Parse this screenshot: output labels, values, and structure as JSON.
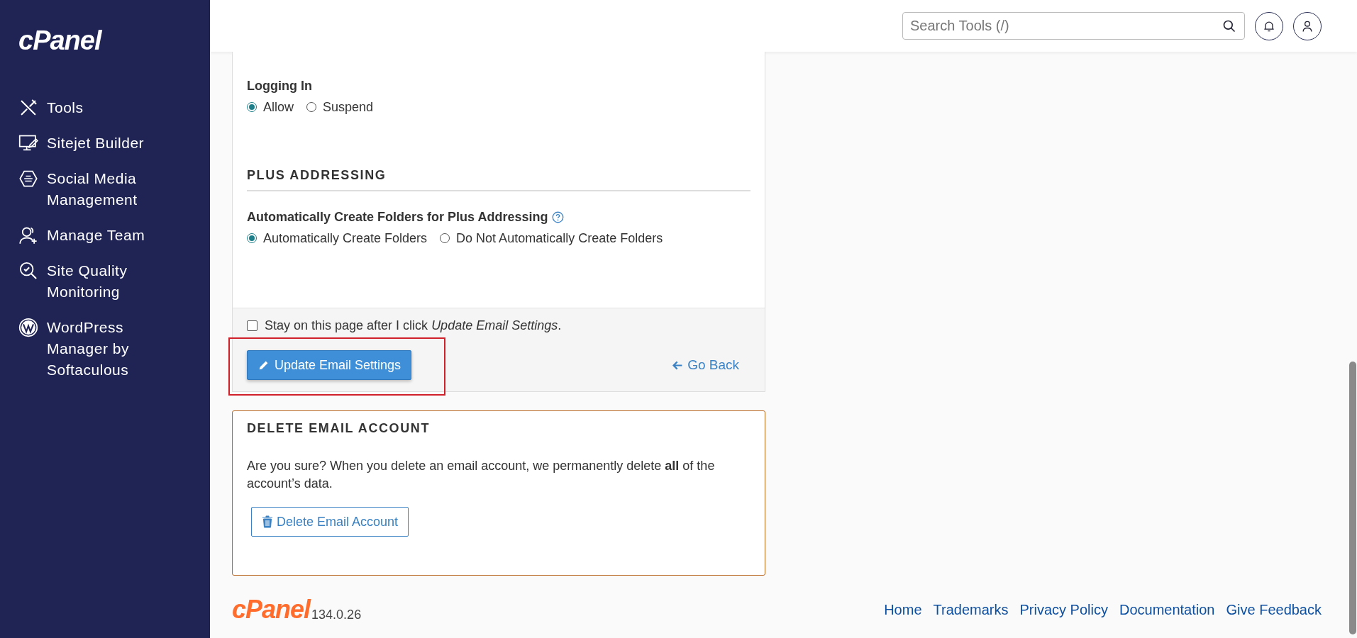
{
  "sidebar": {
    "logo": "cPanel",
    "items": [
      {
        "label": "Tools"
      },
      {
        "label": "Sitejet Builder"
      },
      {
        "label": "Social Media Management"
      },
      {
        "label": "Manage Team"
      },
      {
        "label": "Site Quality Monitoring"
      },
      {
        "label": "WordPress Manager by Softaculous"
      }
    ]
  },
  "header": {
    "search": {
      "placeholder": "Search Tools (/)"
    }
  },
  "settings_card": {
    "logging_in": {
      "label": "Logging In",
      "options": [
        {
          "label": "Allow",
          "selected": true
        },
        {
          "label": "Suspend",
          "selected": false
        }
      ]
    },
    "plus_addressing": {
      "heading": "PLUS ADDRESSING",
      "label": "Automatically Create Folders for Plus Addressing",
      "options": [
        {
          "label": "Automatically Create Folders",
          "selected": true
        },
        {
          "label": "Do Not Automatically Create Folders",
          "selected": false
        }
      ]
    },
    "stay_on_page": {
      "label": "Stay on this page after I click *Update Email Settings*.",
      "checked": false
    },
    "update_button": "Update Email Settings",
    "go_back": "Go Back"
  },
  "delete_card": {
    "heading": "DELETE EMAIL ACCOUNT",
    "text": "Are you sure? When you delete an email account, we permanently delete **all** of the account’s data.",
    "button": "Delete Email Account"
  },
  "footer": {
    "logo": "cPanel",
    "version": "134.0.26",
    "links": [
      "Home",
      "Trademarks",
      "Privacy Policy",
      "Documentation",
      "Give Feedback"
    ]
  }
}
